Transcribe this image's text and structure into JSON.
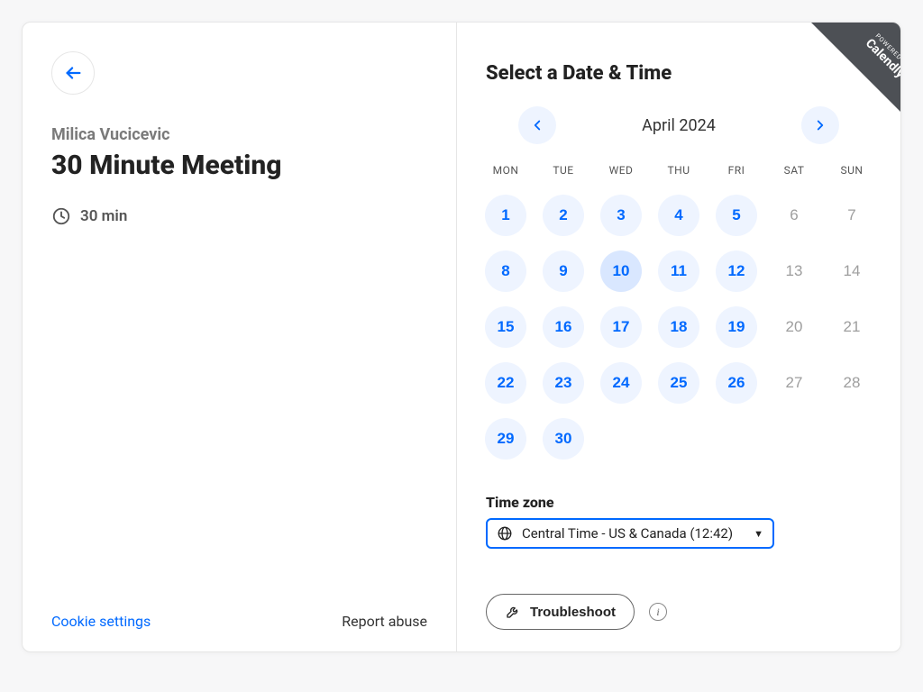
{
  "host_name": "Milica Vucicevic",
  "event_title": "30 Minute Meeting",
  "duration_label": "30 min",
  "footer": {
    "cookie_settings": "Cookie settings",
    "report_abuse": "Report abuse",
    "troubleshoot": "Troubleshoot"
  },
  "ribbon": {
    "powered_by": "POWERED BY",
    "brand": "Calendly"
  },
  "right_heading": "Select a Date & Time",
  "calendar": {
    "month_label": "April 2024",
    "dow": [
      "MON",
      "TUE",
      "WED",
      "THU",
      "FRI",
      "SAT",
      "SUN"
    ],
    "days": [
      {
        "n": "1",
        "state": "available"
      },
      {
        "n": "2",
        "state": "available"
      },
      {
        "n": "3",
        "state": "available"
      },
      {
        "n": "4",
        "state": "available"
      },
      {
        "n": "5",
        "state": "available"
      },
      {
        "n": "6",
        "state": "unavailable"
      },
      {
        "n": "7",
        "state": "unavailable"
      },
      {
        "n": "8",
        "state": "available"
      },
      {
        "n": "9",
        "state": "available"
      },
      {
        "n": "10",
        "state": "today"
      },
      {
        "n": "11",
        "state": "available"
      },
      {
        "n": "12",
        "state": "available"
      },
      {
        "n": "13",
        "state": "unavailable"
      },
      {
        "n": "14",
        "state": "unavailable"
      },
      {
        "n": "15",
        "state": "available"
      },
      {
        "n": "16",
        "state": "available"
      },
      {
        "n": "17",
        "state": "available"
      },
      {
        "n": "18",
        "state": "available"
      },
      {
        "n": "19",
        "state": "available"
      },
      {
        "n": "20",
        "state": "unavailable"
      },
      {
        "n": "21",
        "state": "unavailable"
      },
      {
        "n": "22",
        "state": "available"
      },
      {
        "n": "23",
        "state": "available"
      },
      {
        "n": "24",
        "state": "available"
      },
      {
        "n": "25",
        "state": "available"
      },
      {
        "n": "26",
        "state": "available"
      },
      {
        "n": "27",
        "state": "unavailable"
      },
      {
        "n": "28",
        "state": "unavailable"
      },
      {
        "n": "29",
        "state": "available"
      },
      {
        "n": "30",
        "state": "available"
      },
      {
        "n": "",
        "state": "empty"
      },
      {
        "n": "",
        "state": "empty"
      },
      {
        "n": "",
        "state": "empty"
      },
      {
        "n": "",
        "state": "empty"
      },
      {
        "n": "",
        "state": "empty"
      }
    ]
  },
  "timezone": {
    "label": "Time zone",
    "value": "Central Time - US & Canada (12:42)"
  }
}
